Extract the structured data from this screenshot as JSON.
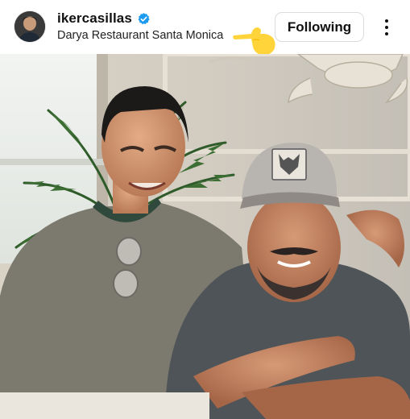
{
  "post": {
    "username": "ikercasillas",
    "location": "Darya Restaurant Santa Monica",
    "follow_label": "Following",
    "verified_icon": "verified-badge-icon",
    "more_icon": "more-options-icon"
  },
  "colors": {
    "verified_blue": "#1d9bf0",
    "pointer_yellow": "#ffd43b",
    "button_border": "#dcdcdc"
  },
  "photo": {
    "cap_patch_text": "Wolf"
  }
}
